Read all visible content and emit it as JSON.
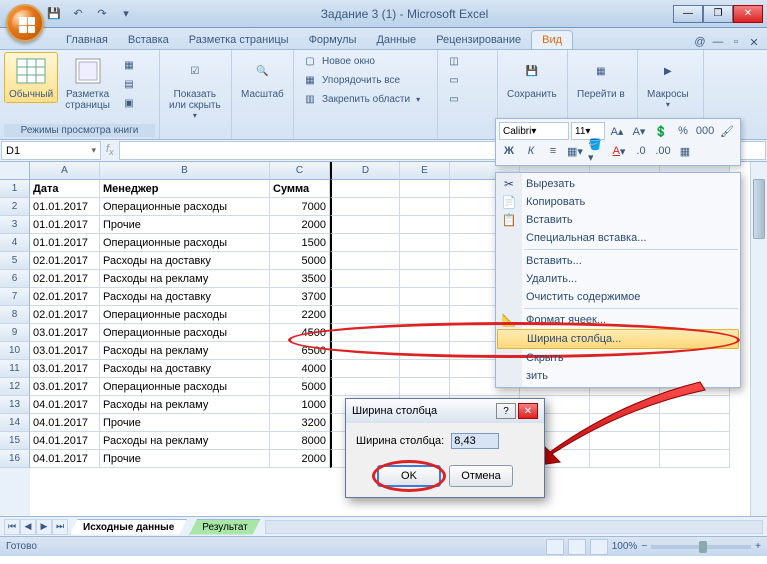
{
  "window": {
    "title": "Задание 3 (1) - Microsoft Excel"
  },
  "tabs": [
    "Главная",
    "Вставка",
    "Разметка страницы",
    "Формулы",
    "Данные",
    "Рецензирование",
    "Вид"
  ],
  "active_tab": 6,
  "ribbon": {
    "views_group": {
      "label": "Режимы просмотра книги",
      "normal": "Обычный",
      "layout": "Разметка\nстраницы"
    },
    "showhide": "Показать\nили скрыть",
    "zoom": "Масштаб",
    "window_group": {
      "new": "Новое окно",
      "arrange": "Упорядочить все",
      "freeze": "Закрепить области"
    },
    "save": "Сохранить",
    "goto": "Перейти в",
    "macros": "Макросы"
  },
  "minitb": {
    "font": "Calibri",
    "size": "11"
  },
  "namebox": "D1",
  "columns": [
    "A",
    "B",
    "C",
    "D",
    "E"
  ],
  "headers": {
    "a": "Дата",
    "b": "Менеджер",
    "c": "Сумма"
  },
  "rows": [
    {
      "a": "01.01.2017",
      "b": "Операционные расходы",
      "c": "7000"
    },
    {
      "a": "01.01.2017",
      "b": "Прочие",
      "c": "2000"
    },
    {
      "a": "01.01.2017",
      "b": "Операционные расходы",
      "c": "1500"
    },
    {
      "a": "02.01.2017",
      "b": "Расходы на доставку",
      "c": "5000"
    },
    {
      "a": "02.01.2017",
      "b": "Расходы на рекламу",
      "c": "3500"
    },
    {
      "a": "02.01.2017",
      "b": "Расходы на доставку",
      "c": "3700"
    },
    {
      "a": "02.01.2017",
      "b": "Операционные расходы",
      "c": "2200"
    },
    {
      "a": "03.01.2017",
      "b": "Операционные расходы",
      "c": "4500"
    },
    {
      "a": "03.01.2017",
      "b": "Расходы на рекламу",
      "c": "6500"
    },
    {
      "a": "03.01.2017",
      "b": "Расходы на доставку",
      "c": "4000"
    },
    {
      "a": "03.01.2017",
      "b": "Операционные расходы",
      "c": "5000"
    },
    {
      "a": "04.01.2017",
      "b": "Расходы на рекламу",
      "c": "1000"
    },
    {
      "a": "04.01.2017",
      "b": "Прочие",
      "c": "3200"
    },
    {
      "a": "04.01.2017",
      "b": "Расходы на рекламу",
      "c": "8000"
    },
    {
      "a": "04.01.2017",
      "b": "Прочие",
      "c": "2000"
    }
  ],
  "sheets": {
    "s1": "Исходные данные",
    "s2": "Результат"
  },
  "status": {
    "ready": "Готово",
    "zoom": "100%"
  },
  "ctx": {
    "cut": "Вырезать",
    "copy": "Копировать",
    "paste": "Вставить",
    "pspecial": "Специальная вставка...",
    "insert": "Вставить...",
    "delete": "Удалить...",
    "clear": "Очистить содержимое",
    "format": "Формат ячеек...",
    "colwidth": "Ширина столбца...",
    "hide": "Скрыть",
    "unhide": "зить"
  },
  "dialog": {
    "title": "Ширина столбца",
    "label": "Ширина столбца:",
    "value": "8,43",
    "ok": "OK",
    "cancel": "Отмена"
  }
}
